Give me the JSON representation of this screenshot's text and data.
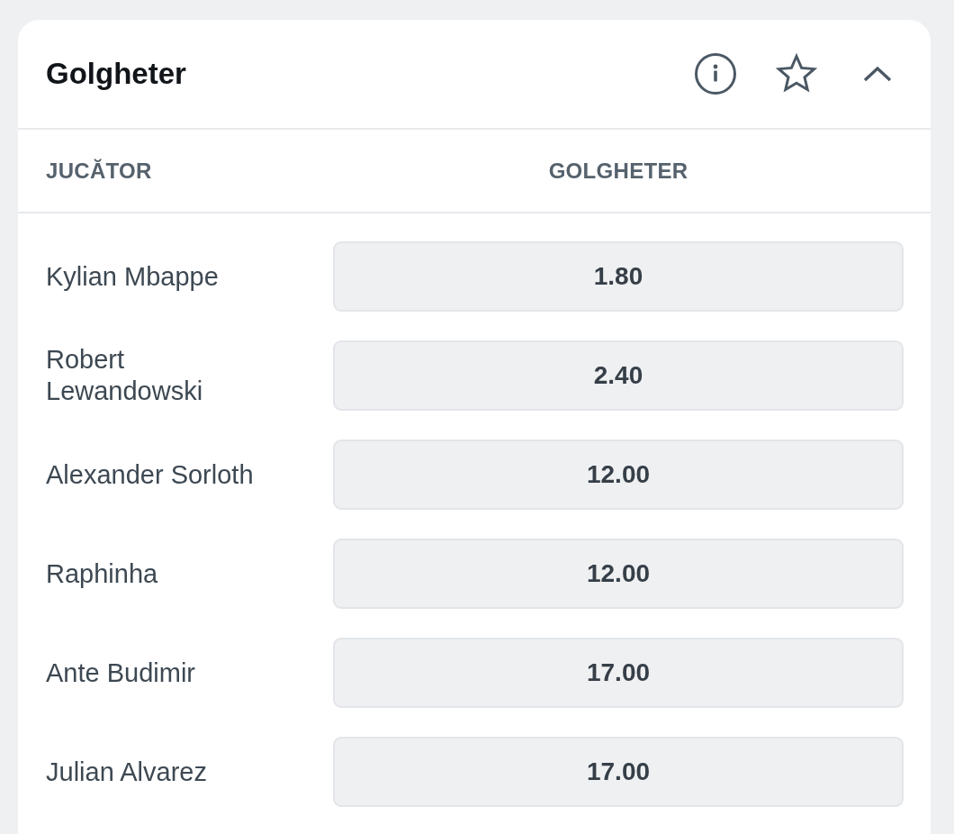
{
  "header": {
    "title": "Golgheter",
    "favorite": false,
    "expanded": true
  },
  "columns": [
    "JUCĂTOR",
    "GOLGHETER"
  ],
  "rows": [
    {
      "player": "Kylian Mbappe",
      "odds": "1.80",
      "selected": false
    },
    {
      "player": "Robert Lewandowski",
      "odds": "2.40",
      "selected": false
    },
    {
      "player": "Alexander Sorloth",
      "odds": "12.00",
      "selected": false
    },
    {
      "player": "Raphinha",
      "odds": "12.00",
      "selected": false
    },
    {
      "player": "Ante Budimir",
      "odds": "17.00",
      "selected": false
    },
    {
      "player": "Julian Alvarez",
      "odds": "17.00",
      "selected": false
    }
  ]
}
